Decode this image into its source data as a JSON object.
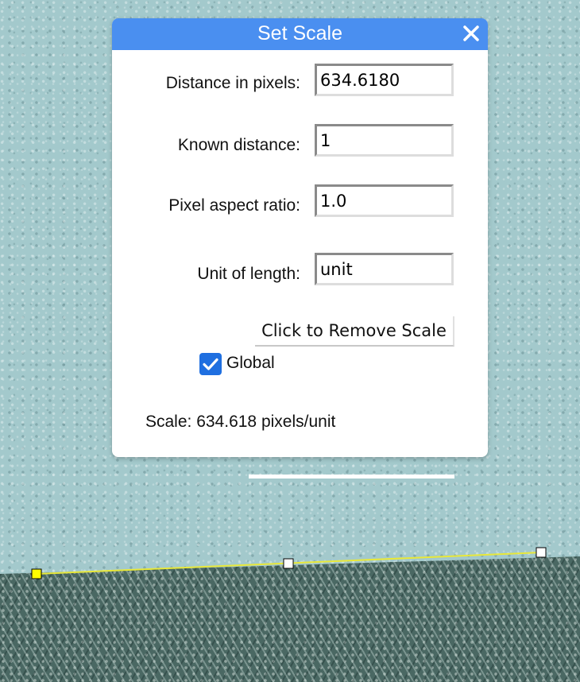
{
  "dialog": {
    "title": "Set Scale",
    "close_label": "×",
    "fields": {
      "distance_pixels": {
        "label": "Distance in pixels:",
        "value": "634.6180"
      },
      "known_distance": {
        "label": "Known distance:",
        "value": "1"
      },
      "pixel_aspect_ratio": {
        "label": "Pixel aspect ratio:",
        "value": "1.0"
      },
      "unit_of_length": {
        "label": "Unit of length:",
        "value": "unit"
      }
    },
    "remove_scale_label": "Click to Remove Scale",
    "global": {
      "label": "Global",
      "checked": true
    },
    "scale_text": "Scale: 634.618 pixels/unit"
  },
  "colors": {
    "header": "#4a8ff0",
    "checkbox": "#1f6fe0",
    "measure_line": "#e8e83a",
    "selected_handle": "#ffff00"
  },
  "icons": {
    "close": "close-icon",
    "check": "checkmark-icon"
  }
}
